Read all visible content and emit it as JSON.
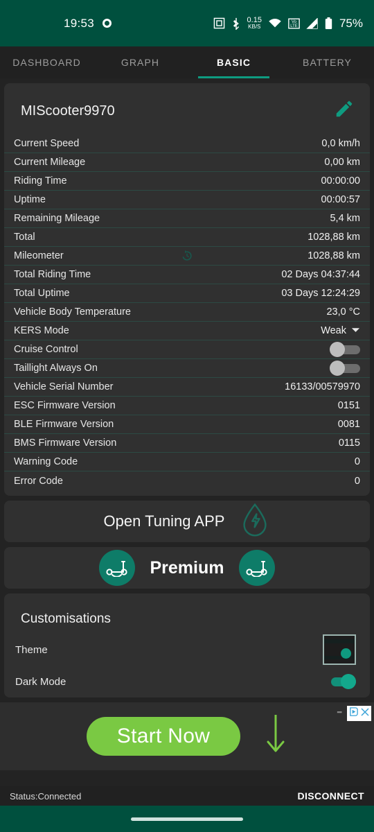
{
  "system_bar": {
    "clock": "19:53",
    "battery_percent": "75%",
    "net_speed_value": "0.15",
    "net_speed_unit": "KB/S",
    "icons": [
      "nfc-icon",
      "bluetooth-icon",
      "network-speed-icon",
      "wifi-icon",
      "volte-icon",
      "cellular-signal-icon",
      "battery-icon"
    ]
  },
  "tabs": [
    {
      "label": "DASHBOARD",
      "active": false
    },
    {
      "label": "GRAPH",
      "active": false
    },
    {
      "label": "BASIC",
      "active": true
    },
    {
      "label": "BATTERY",
      "active": false
    }
  ],
  "device": {
    "name": "MIScooter9970",
    "edit_icon": "pencil-icon"
  },
  "info_rows": [
    {
      "label": "Current Speed",
      "value": "0,0 km/h"
    },
    {
      "label": "Current Mileage",
      "value": "0,00 km"
    },
    {
      "label": "Riding Time",
      "value": "00:00:00"
    },
    {
      "label": "Uptime",
      "value": "00:00:57"
    },
    {
      "label": "Remaining Mileage",
      "value": "5,4 km"
    },
    {
      "label": "Total",
      "value": "1028,88 km"
    },
    {
      "label": "Mileometer",
      "value": "1028,88 km",
      "mid_icon": "history-reset-icon"
    },
    {
      "label": "Total Riding Time",
      "value": "02 Days 04:37:44"
    },
    {
      "label": "Total Uptime",
      "value": "03 Days 12:24:29"
    },
    {
      "label": "Vehicle Body Temperature",
      "value": "23,0 °C"
    },
    {
      "label": "KERS Mode",
      "value": "Weak",
      "type": "dropdown"
    },
    {
      "label": "Cruise Control",
      "type": "switch",
      "on": false
    },
    {
      "label": "Taillight Always On",
      "type": "switch",
      "on": false
    },
    {
      "label": "Vehicle Serial Number",
      "value": "16133/00579970"
    },
    {
      "label": "ESC Firmware Version",
      "value": "0151"
    },
    {
      "label": "BLE Firmware Version",
      "value": "0081"
    },
    {
      "label": "BMS Firmware Version",
      "value": "0115"
    },
    {
      "label": "Warning Code",
      "value": "0"
    },
    {
      "label": "Error Code",
      "value": "0"
    }
  ],
  "tuning_card": {
    "label": "Open Tuning APP",
    "icon": "energy-drop-icon"
  },
  "premium_card": {
    "label": "Premium",
    "left_icon": "scooter-icon",
    "right_icon": "scooter-icon"
  },
  "customisations": {
    "title": "Customisations",
    "theme": {
      "label": "Theme",
      "preview_icon": "theme-preview-swatch"
    },
    "dark_mode": {
      "label": "Dark Mode",
      "on": true
    }
  },
  "ad": {
    "cta_label": "Start Now",
    "arrow_icon": "down-arrow-icon",
    "adchoices_icon": "adchoices-icon",
    "close_icon": "close-icon",
    "dots": "▪▪▪"
  },
  "bottom_status": {
    "status_text": "Status:Connected",
    "disconnect_label": "DISCONNECT"
  },
  "colors": {
    "accent_teal": "#0e9b80",
    "system_bar_green": "#00503e",
    "card_bg": "#303030",
    "page_bg": "#232323",
    "ad_green": "#7ac943"
  }
}
